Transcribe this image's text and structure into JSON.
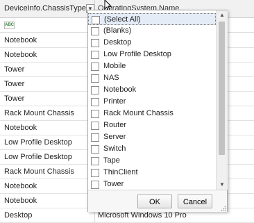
{
  "grid": {
    "col1_header": "DeviceInfo.ChassisType",
    "col2_header": "OperatingSystem.Name",
    "filter_button_glyph": "▼",
    "auto_filter_icon": "abc-filter-icon",
    "auto_filter_glyph": "ABC",
    "rows": [
      {
        "c1": "Notebook",
        "c2": ""
      },
      {
        "c1": "Notebook",
        "c2": ""
      },
      {
        "c1": "Tower",
        "c2": "acenter"
      },
      {
        "c1": "Tower",
        "c2": "ndard"
      },
      {
        "c1": "Tower",
        "c2": "ndard"
      },
      {
        "c1": "Rack Mount Chassis",
        "c2": "ndard"
      },
      {
        "c1": "Notebook",
        "c2": ""
      },
      {
        "c1": "Low Profile Desktop",
        "c2": ""
      },
      {
        "c1": "Low Profile Desktop",
        "c2": ""
      },
      {
        "c1": "Rack Mount Chassis",
        "c2": "rd"
      },
      {
        "c1": "Notebook",
        "c2": ""
      },
      {
        "c1": "Notebook",
        "c2": ""
      },
      {
        "c1": "Desktop",
        "c2": "Microsoft Windows 10 Pro"
      }
    ]
  },
  "filter_popup": {
    "items": [
      {
        "label": "(Select All)",
        "checked": false
      },
      {
        "label": "(Blanks)",
        "checked": false
      },
      {
        "label": "Desktop",
        "checked": false
      },
      {
        "label": "Low Profile Desktop",
        "checked": false
      },
      {
        "label": "Mobile",
        "checked": false
      },
      {
        "label": "NAS",
        "checked": false
      },
      {
        "label": "Notebook",
        "checked": false
      },
      {
        "label": "Printer",
        "checked": false
      },
      {
        "label": "Rack Mount Chassis",
        "checked": false
      },
      {
        "label": "Router",
        "checked": false
      },
      {
        "label": "Server",
        "checked": false
      },
      {
        "label": "Switch",
        "checked": false
      },
      {
        "label": "Tape",
        "checked": false
      },
      {
        "label": "ThinClient",
        "checked": false
      },
      {
        "label": "Tower",
        "checked": false
      }
    ],
    "scroll_up_glyph": "▲",
    "scroll_down_glyph": "▼",
    "ok_label": "OK",
    "cancel_label": "Cancel"
  }
}
